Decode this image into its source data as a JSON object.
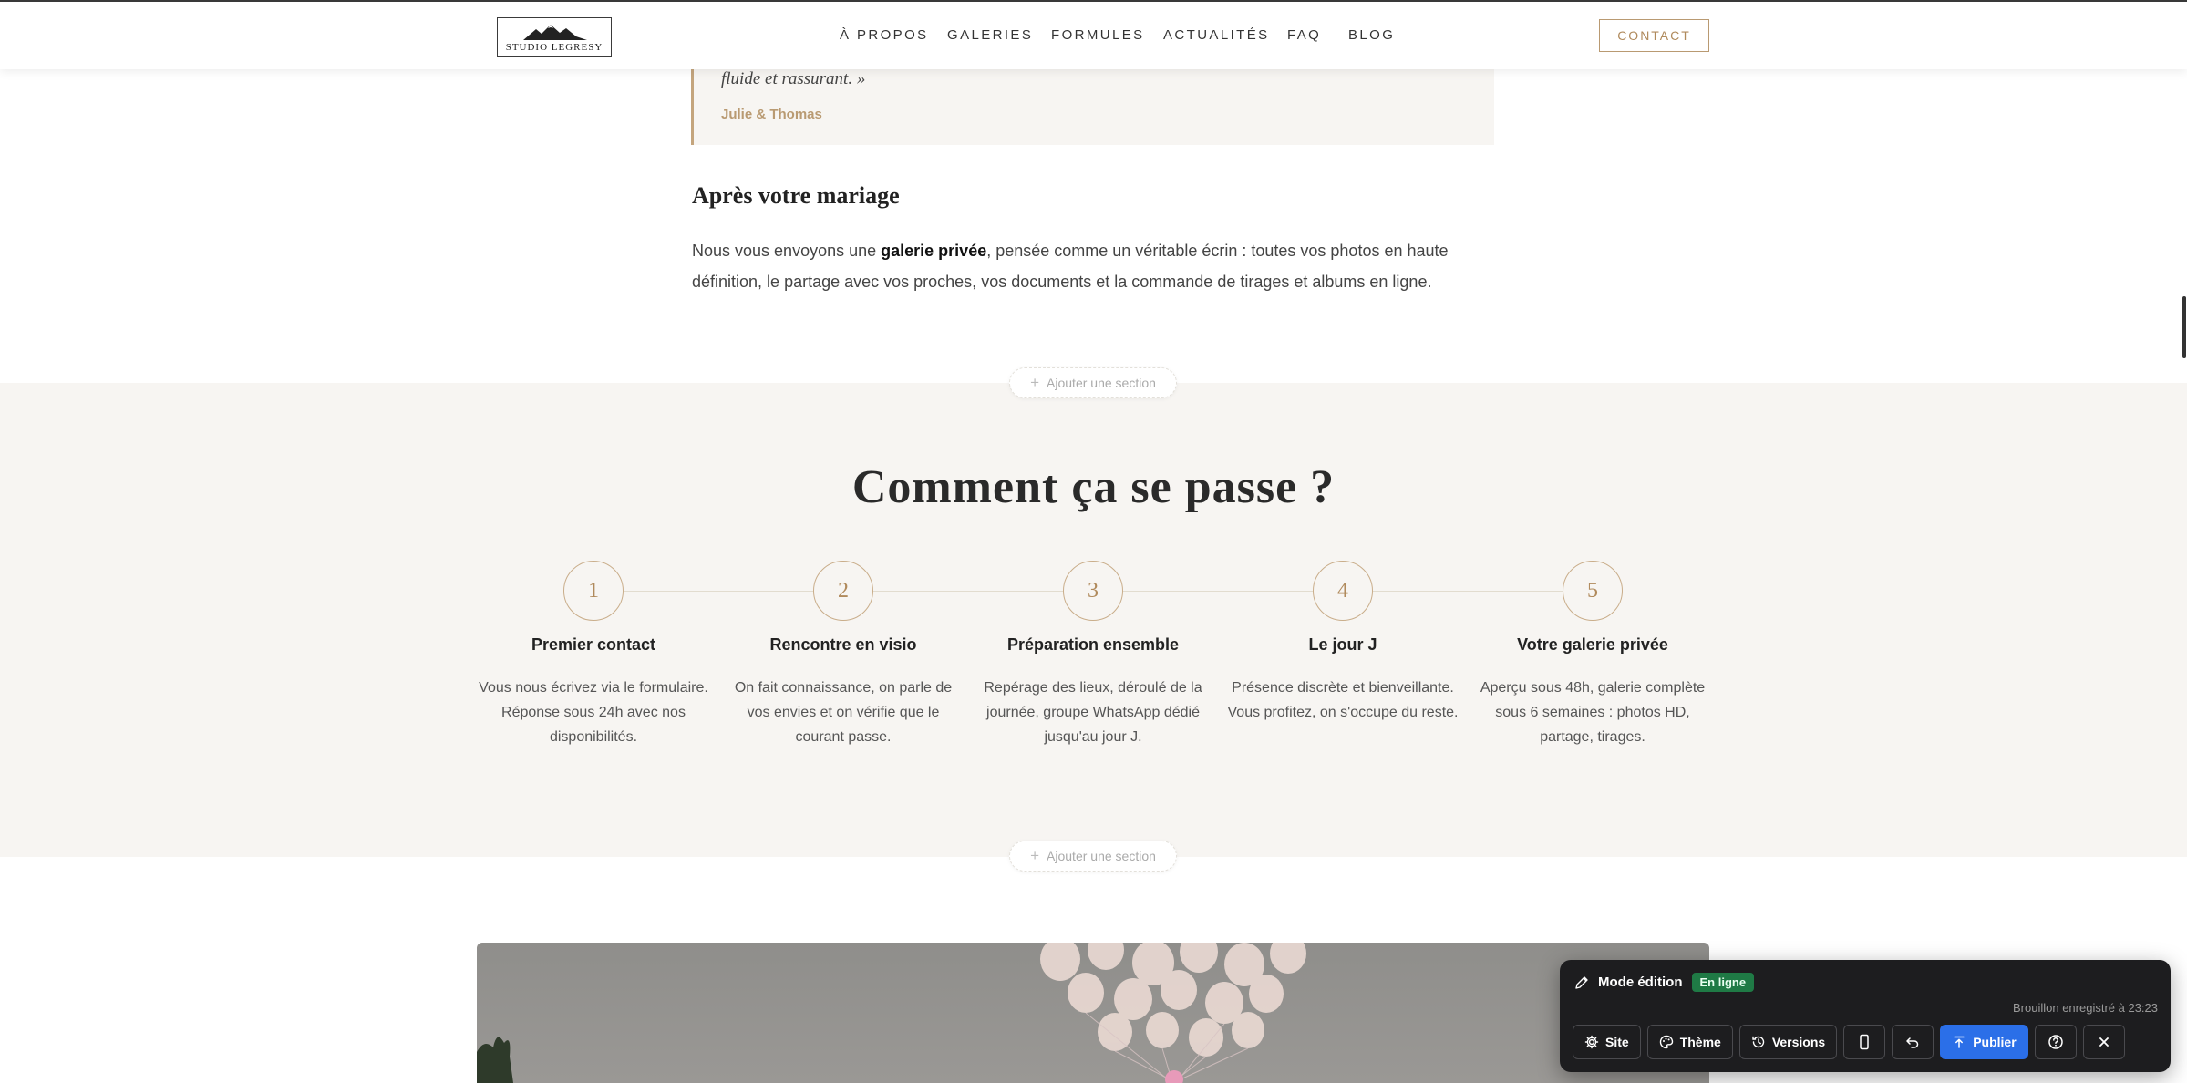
{
  "header": {
    "logo_text": "STUDIO LEGRESY",
    "nav": [
      "À PROPOS",
      "GALERIES",
      "FORMULES",
      "ACTUALITÉS",
      "FAQ",
      "BLOG"
    ],
    "contact_label": "CONTACT"
  },
  "quote": {
    "text": "fluide et rassurant. »",
    "author": "Julie & Thomas"
  },
  "after": {
    "title": "Après votre mariage",
    "text_before": "Nous vous envoyons une ",
    "text_bold": "galerie privée",
    "text_after": ", pensée comme un véritable écrin : toutes vos photos en haute définition, le partage avec vos proches, vos documents et la commande de tirages et albums en ligne."
  },
  "add_section_label": "Ajouter une section",
  "steps": {
    "title": "Comment ça se passe ?",
    "items": [
      {
        "number": "1",
        "title": "Premier contact",
        "desc": "Vous nous écrivez via le formulaire. Réponse sous 24h avec nos disponibilités."
      },
      {
        "number": "2",
        "title": "Rencontre en visio",
        "desc": "On fait connaissance, on parle de vos envies et on vérifie que le courant passe."
      },
      {
        "number": "3",
        "title": "Préparation ensemble",
        "desc": "Repérage des lieux, déroulé de la journée, groupe WhatsApp dédié jusqu'au jour J."
      },
      {
        "number": "4",
        "title": "Le jour J",
        "desc": "Présence discrète et bienveillante. Vous profitez, on s'occupe du reste."
      },
      {
        "number": "5",
        "title": "Votre galerie privée",
        "desc": "Aperçu sous 48h, galerie complète sous 6 semaines : photos HD, partage, tirages."
      }
    ]
  },
  "editbar": {
    "mode_label": "Mode édition",
    "status_badge": "En ligne",
    "saved_text": "Brouillon enregistré à 23:23",
    "site_label": "Site",
    "theme_label": "Thème",
    "versions_label": "Versions",
    "publish_label": "Publier"
  },
  "colors": {
    "accent": "#b99a72",
    "section_bg": "#f7f5f2",
    "publish": "#2b6fe8",
    "online_badge": "#1f7a45"
  },
  "icons": {
    "edit": "pencil-icon",
    "site": "gear-icon",
    "theme": "palette-icon",
    "versions": "history-icon",
    "device": "mobile-icon",
    "undo": "undo-icon",
    "publish": "upload-icon",
    "help": "help-icon",
    "close": "close-icon"
  }
}
